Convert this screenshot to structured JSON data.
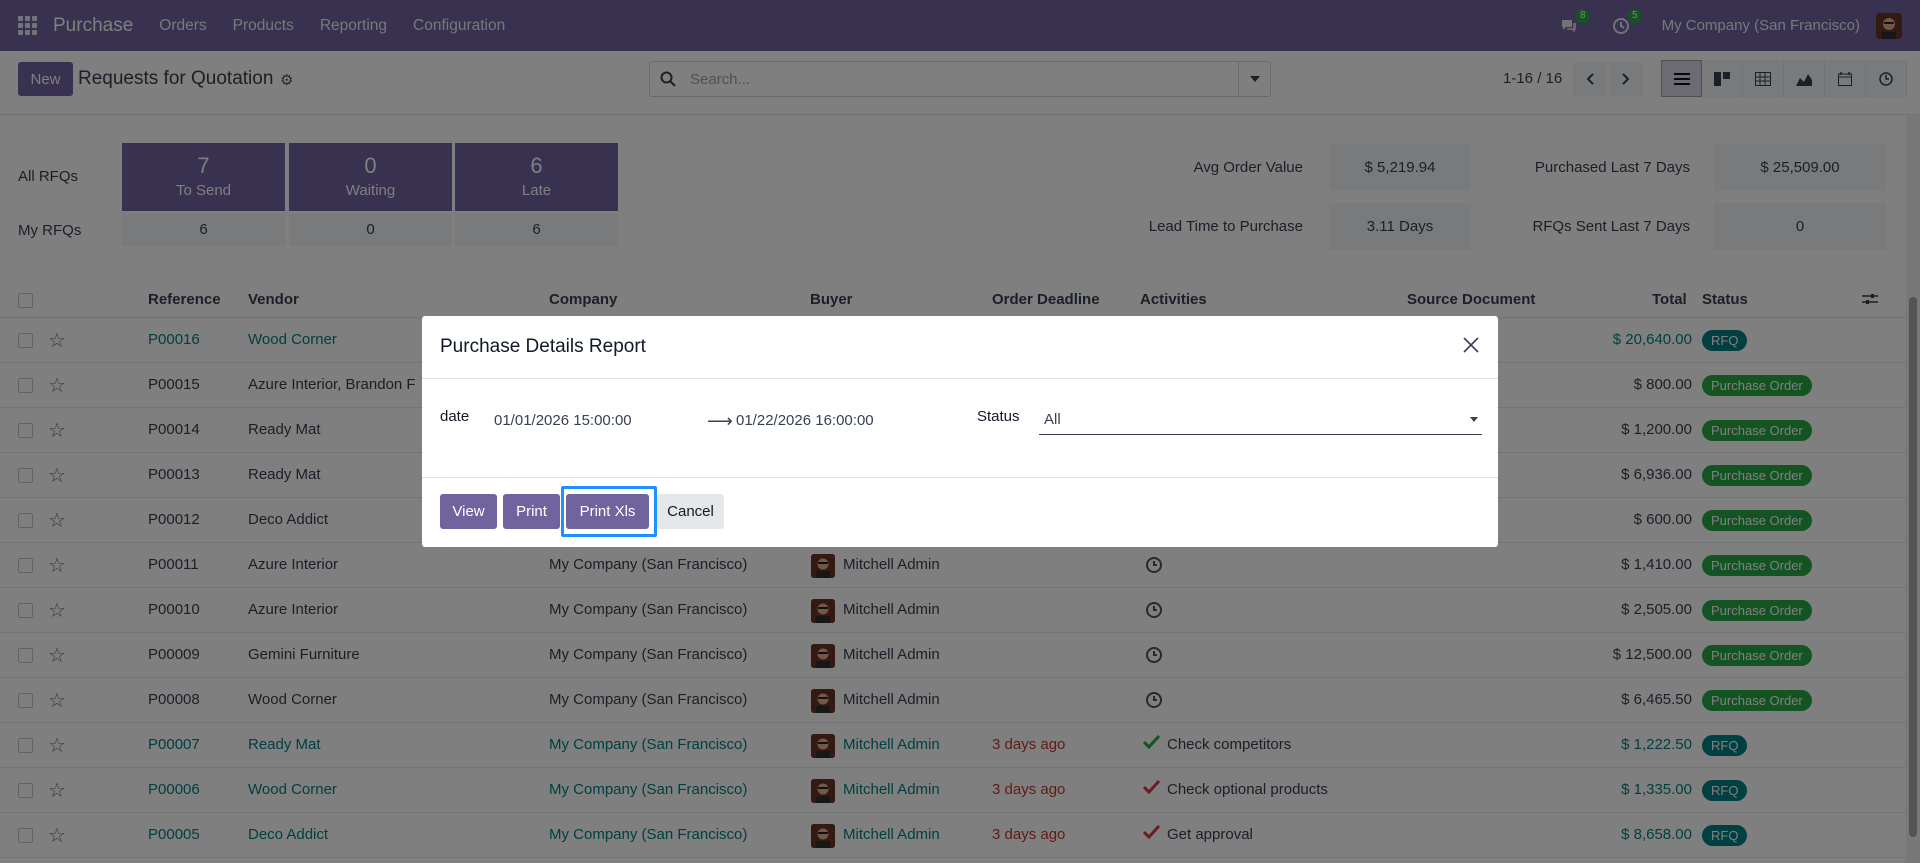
{
  "nav": {
    "app_name": "Purchase",
    "menus": [
      "Orders",
      "Products",
      "Reporting",
      "Configuration"
    ],
    "messages_count": "8",
    "activities_count": "5",
    "company": "My Company (San Francisco)"
  },
  "control": {
    "new_label": "New",
    "title": "Requests for Quotation",
    "search_placeholder": "Search...",
    "pager": "1-16 / 16"
  },
  "dashboard": {
    "all_rfqs_label": "All RFQs",
    "my_rfqs_label": "My RFQs",
    "tiles": [
      {
        "num": "7",
        "label": "To Send",
        "mine": "6"
      },
      {
        "num": "0",
        "label": "Waiting",
        "mine": "0"
      },
      {
        "num": "6",
        "label": "Late",
        "mine": "6"
      }
    ],
    "kpis": [
      {
        "label": "Avg Order Value",
        "value": "$ 5,219.94"
      },
      {
        "label": "Purchased Last 7 Days",
        "value": "$ 25,509.00"
      },
      {
        "label": "Lead Time to Purchase",
        "value": "3.11 Days"
      },
      {
        "label": "RFQs Sent Last 7 Days",
        "value": "0"
      }
    ]
  },
  "table": {
    "headers": {
      "reference": "Reference",
      "vendor": "Vendor",
      "company": "Company",
      "buyer": "Buyer",
      "deadline": "Order Deadline",
      "activities": "Activities",
      "source": "Source Document",
      "total": "Total",
      "status": "Status"
    },
    "rows": [
      {
        "ref": "P00016",
        "vendor": "Wood Corner",
        "company": "",
        "buyer": "",
        "deadline": "",
        "activity": "",
        "total": "$ 20,640.00",
        "status": "RFQ"
      },
      {
        "ref": "P00015",
        "vendor": "Azure Interior, Brandon F",
        "company": "",
        "buyer": "",
        "deadline": "",
        "activity": "",
        "total": "$ 800.00",
        "status": "Purchase Order"
      },
      {
        "ref": "P00014",
        "vendor": "Ready Mat",
        "company": "",
        "buyer": "",
        "deadline": "",
        "activity": "",
        "total": "$ 1,200.00",
        "status": "Purchase Order"
      },
      {
        "ref": "P00013",
        "vendor": "Ready Mat",
        "company": "",
        "buyer": "",
        "deadline": "",
        "activity": "",
        "total": "$ 6,936.00",
        "status": "Purchase Order"
      },
      {
        "ref": "P00012",
        "vendor": "Deco Addict",
        "company": "",
        "buyer": "",
        "deadline": "",
        "activity": "",
        "total": "$ 600.00",
        "status": "Purchase Order"
      },
      {
        "ref": "P00011",
        "vendor": "Azure Interior",
        "company": "My Company (San Francisco)",
        "buyer": "Mitchell Admin",
        "deadline": "",
        "activity": "",
        "total": "$ 1,410.00",
        "status": "Purchase Order"
      },
      {
        "ref": "P00010",
        "vendor": "Azure Interior",
        "company": "My Company (San Francisco)",
        "buyer": "Mitchell Admin",
        "deadline": "",
        "activity": "",
        "total": "$ 2,505.00",
        "status": "Purchase Order"
      },
      {
        "ref": "P00009",
        "vendor": "Gemini Furniture",
        "company": "My Company (San Francisco)",
        "buyer": "Mitchell Admin",
        "deadline": "",
        "activity": "",
        "total": "$ 12,500.00",
        "status": "Purchase Order"
      },
      {
        "ref": "P00008",
        "vendor": "Wood Corner",
        "company": "My Company (San Francisco)",
        "buyer": "Mitchell Admin",
        "deadline": "",
        "activity": "",
        "total": "$ 6,465.50",
        "status": "Purchase Order"
      },
      {
        "ref": "P00007",
        "vendor": "Ready Mat",
        "company": "My Company (San Francisco)",
        "buyer": "Mitchell Admin",
        "deadline": "3 days ago",
        "activity": "Check competitors",
        "total": "$ 1,222.50",
        "status": "RFQ"
      },
      {
        "ref": "P00006",
        "vendor": "Wood Corner",
        "company": "My Company (San Francisco)",
        "buyer": "Mitchell Admin",
        "deadline": "3 days ago",
        "activity": "Check optional products",
        "total": "$ 1,335.00",
        "status": "RFQ"
      },
      {
        "ref": "P00005",
        "vendor": "Deco Addict",
        "company": "My Company (San Francisco)",
        "buyer": "Mitchell Admin",
        "deadline": "3 days ago",
        "activity": "Get approval",
        "total": "$ 8,658.00",
        "status": "RFQ"
      }
    ]
  },
  "modal": {
    "title": "Purchase Details Report",
    "date_label": "date",
    "date_from": "01/01/2026 15:00:00",
    "date_to": "01/22/2026 16:00:00",
    "status_label": "Status",
    "status_value": "All",
    "buttons": {
      "view": "View",
      "print": "Print",
      "print_xls": "Print Xls",
      "cancel": "Cancel"
    }
  }
}
